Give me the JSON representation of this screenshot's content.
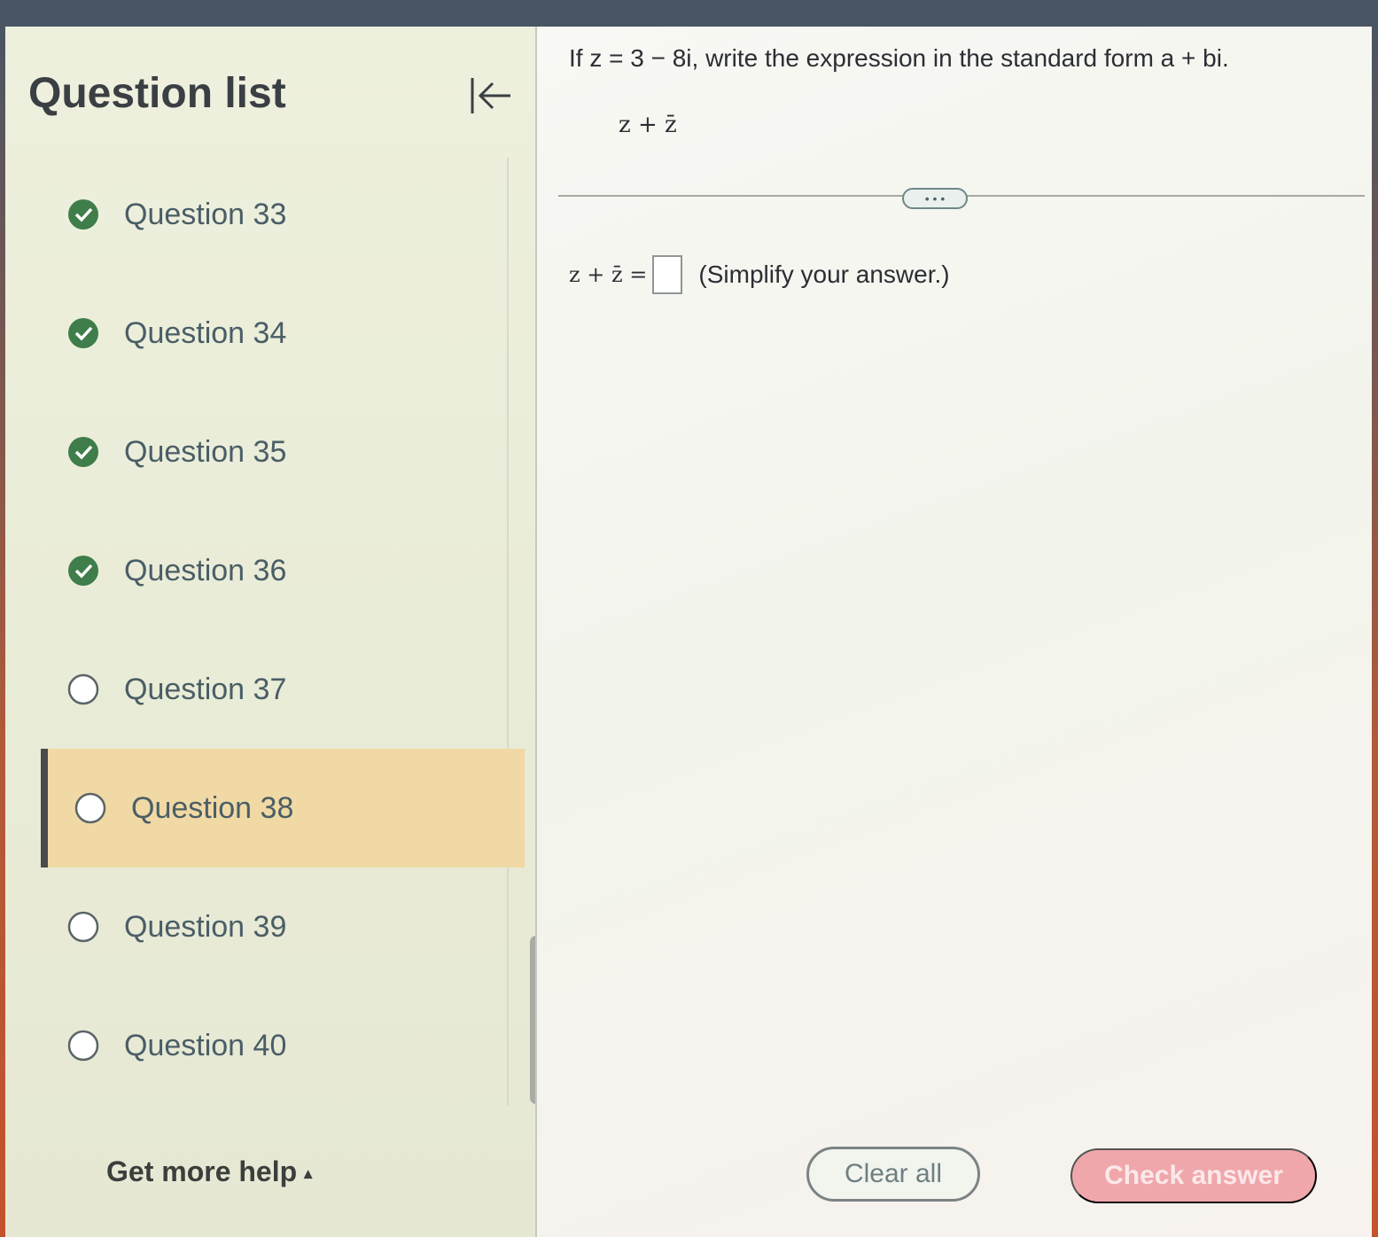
{
  "sidebar": {
    "title": "Question list",
    "collapse_icon": "collapse-left-icon",
    "questions": [
      {
        "label": "Question 33",
        "status": "complete"
      },
      {
        "label": "Question 34",
        "status": "complete"
      },
      {
        "label": "Question 35",
        "status": "complete"
      },
      {
        "label": "Question 36",
        "status": "complete"
      },
      {
        "label": "Question 37",
        "status": "incomplete"
      },
      {
        "label": "Question 38",
        "status": "incomplete",
        "selected": true
      },
      {
        "label": "Question 39",
        "status": "incomplete"
      },
      {
        "label": "Question 40",
        "status": "incomplete"
      }
    ],
    "help_label": "Get more help",
    "help_caret": "▴"
  },
  "question": {
    "prompt": "If z = 3 − 8i, write the expression in the standard form a + bi.",
    "expression": "z + z̄",
    "more_label": "• • •",
    "answer_lhs": "z + z̄ =",
    "answer_value": "",
    "instruction": "(Simplify your answer.)"
  },
  "actions": {
    "clear_label": "Clear all",
    "check_label": "Check answer"
  },
  "colors": {
    "check_green": "#3f7d4a",
    "selected_bg": "#f0d9a4",
    "check_button": "#f0a7ab"
  }
}
